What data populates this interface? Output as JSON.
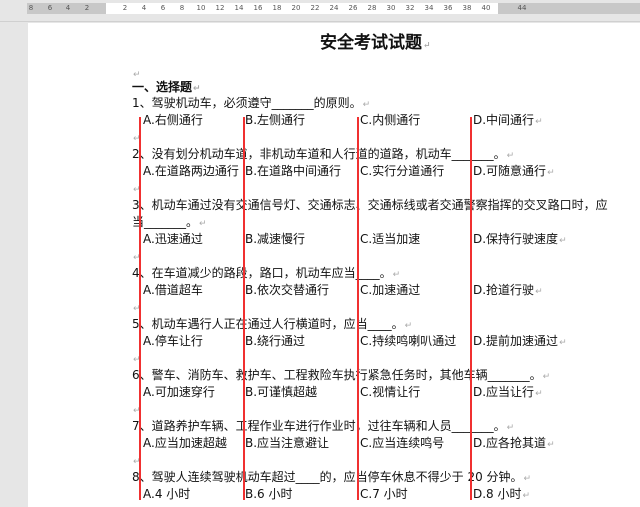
{
  "ruler": {
    "ticks": [
      "8",
      "6",
      "4",
      "2",
      "2",
      "4",
      "6",
      "8",
      "10",
      "12",
      "14",
      "16",
      "18",
      "20",
      "22",
      "24",
      "26",
      "28",
      "30",
      "32",
      "34",
      "36",
      "38",
      "40",
      "44"
    ]
  },
  "document": {
    "title": "安全考试试题",
    "section": "一、选择题",
    "questions": [
      {
        "text": [
          "1、驾驶机动车，必须遵守_______的原则。"
        ],
        "options": [
          "A.右侧通行",
          "B.左侧通行",
          "C.内侧通行",
          "D.中间通行"
        ]
      },
      {
        "text": [
          "2、没有划分机动车道，非机动车道和人行道的道路，机动车_______。"
        ],
        "options": [
          "A.在道路两边通行",
          "B.在道路中间通行",
          "C.实行分道通行",
          "D.可随意通行"
        ]
      },
      {
        "text": [
          "3、机动车通过没有交通信号灯、交通标志、交通标线或者交通警察指挥的交叉路口时，应",
          "当_______。"
        ],
        "options": [
          "A.迅速通过",
          "B.减速慢行",
          "C.适当加速",
          "D.保持行驶速度"
        ]
      },
      {
        "text": [
          "4、在车道减少的路段，路口，机动车应当____。"
        ],
        "options": [
          "A.借道超车",
          "B.依次交替通行",
          "C.加速通过",
          "D.抢道行驶"
        ]
      },
      {
        "text": [
          "5、机动车遇行人正在通过人行横道时，应当____。"
        ],
        "options": [
          "A.停车让行",
          "B.绕行通过",
          "C.持续鸣喇叭通过",
          "D.提前加速通过"
        ]
      },
      {
        "text": [
          "6、警车、消防车、救护车、工程救险车执行紧急任务时，其他车辆_______。"
        ],
        "options": [
          "A.可加速穿行",
          "B.可谨慎超越",
          "C.视情让行",
          "D.应当让行"
        ]
      },
      {
        "text": [
          "7、道路养护车辆、工程作业车进行作业时，过往车辆和人员_______。"
        ],
        "options": [
          "A.应当加速超越",
          "B.应当注意避让",
          "C.应当连续鸣号",
          "D.应各抢其道"
        ]
      },
      {
        "text": [
          "8、驾驶人连续驾驶机动车超过____的，应当停车休息不得少于 20 分钟。"
        ],
        "options": [
          "A.4 小时",
          "B.6 小时",
          "C.7 小时",
          "D.8 小时"
        ]
      }
    ]
  },
  "colors": {
    "red_line": "#f03030"
  }
}
